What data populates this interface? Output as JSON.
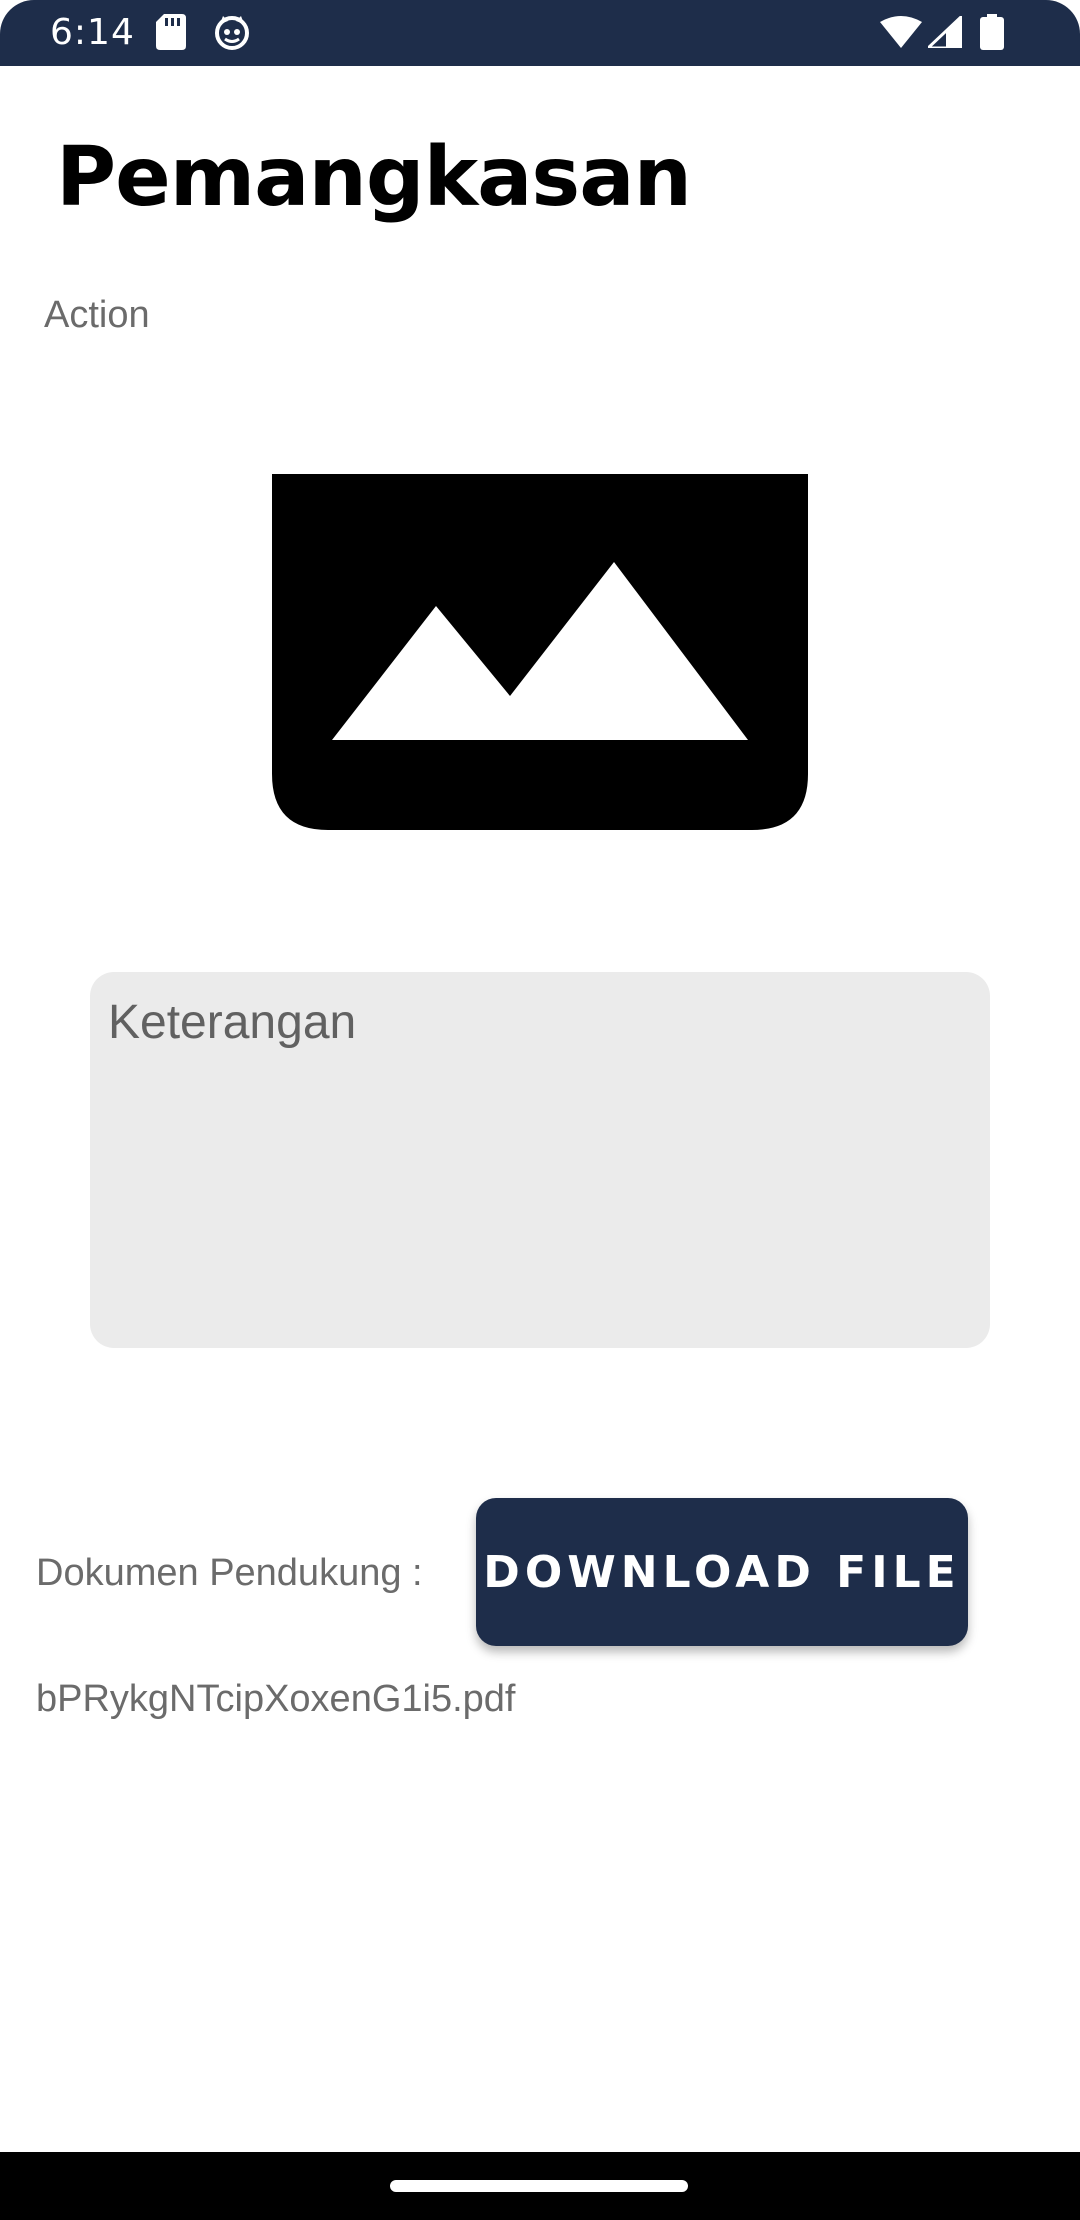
{
  "status_bar": {
    "time": "6:14",
    "left_icons": [
      "sd-card-icon",
      "cat-face-icon"
    ],
    "right_icons": [
      "wifi-icon",
      "signal-icon",
      "battery-icon"
    ],
    "background_color": "#1e2d4a"
  },
  "header": {
    "title": "Pemangkasan",
    "subtitle": "Action"
  },
  "main": {
    "image_icon": "image-placeholder-icon",
    "notes": {
      "placeholder": "Keterangan"
    },
    "document": {
      "label": "Dokumen Pendukung :",
      "download_label": "DOWNLOAD FILE",
      "file_name": "bPRykgNTcipXoxenG1i5.pdf"
    }
  },
  "colors": {
    "primary": "#1e2d4a",
    "text_secondary": "#6b6b6b",
    "input_bg": "#ebebeb"
  }
}
